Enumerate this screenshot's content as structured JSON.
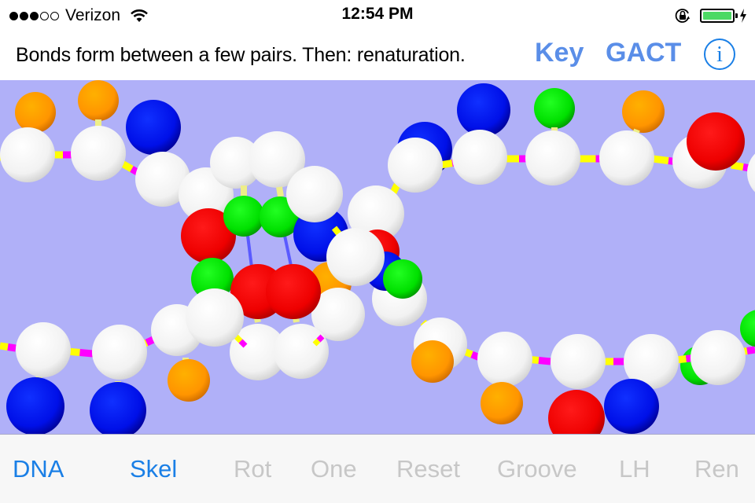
{
  "status_bar": {
    "signal_bars_filled": 3,
    "signal_bars_total": 5,
    "carrier": "Verizon",
    "time": "12:54 PM",
    "battery_level": 1.0,
    "charging": true,
    "rotation_lock": true
  },
  "header": {
    "instruction": "Bonds form between a few pairs. Then: renaturation.",
    "key_label": "Key",
    "gact_label": "GACT",
    "info_label": "i"
  },
  "scene": {
    "background_color": "#b0b0f8",
    "colors": {
      "sugar": "#ffffff",
      "guanine": "#ff0000",
      "adenine": "#0000ff",
      "cytosine": "#00e000",
      "thymine": "#ff9900",
      "phosphate_a": "#ffff00",
      "phosphate_b": "#ff00ff",
      "hydrogen_bond": "#5a5aff"
    }
  },
  "toolbar": {
    "items": [
      {
        "label": "DNA",
        "state": "active"
      },
      {
        "label": "Skel",
        "state": "active"
      },
      {
        "label": "Rot",
        "state": "disabled"
      },
      {
        "label": "One",
        "state": "disabled"
      },
      {
        "label": "Reset",
        "state": "disabled"
      },
      {
        "label": "Groove",
        "state": "disabled"
      },
      {
        "label": "LH",
        "state": "disabled"
      },
      {
        "label": "Ren",
        "state": "disabled"
      }
    ]
  }
}
